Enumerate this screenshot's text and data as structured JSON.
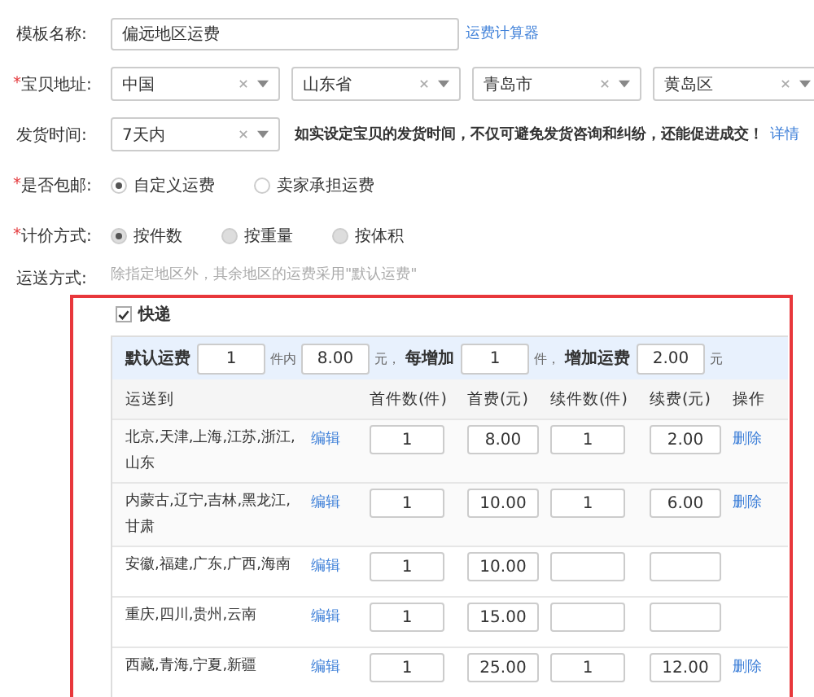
{
  "form": {
    "fields": [
      {
        "kind": "text",
        "label": "模板名称:",
        "value": "偏远地区运费",
        "link": "运费计算器"
      },
      {
        "kind": "selects",
        "label": "宝贝地址:",
        "marker": "*",
        "selects": [
          "中国",
          "山东省",
          "青岛市",
          "黄岛区"
        ]
      },
      {
        "kind": "select",
        "label": "发货时间:",
        "value": "7天内",
        "note": "如实设定宝贝的发货时间，不仅可避免发货咨询和纠纷，还能促进成交！",
        "link": "详情"
      },
      {
        "kind": "radios",
        "label": "是否包邮:",
        "marker": "*",
        "disabled": false,
        "options": [
          {
            "label": "自定义运费",
            "selected": true
          },
          {
            "label": "卖家承担运费",
            "selected": false
          }
        ]
      },
      {
        "kind": "radios",
        "label": "计价方式:",
        "marker": "*",
        "disabled": true,
        "options": [
          {
            "label": "按件数",
            "selected": true
          },
          {
            "label": "按重量",
            "selected": false
          },
          {
            "label": "按体积",
            "selected": false
          }
        ]
      }
    ],
    "shipping": {
      "label": "运送方式:",
      "hint": "除指定地区外，其余地区的运费采用\"默认运费\"",
      "method": {
        "label": "快递",
        "checked": true
      },
      "default_rule": [
        {
          "kind": "label",
          "text": "默认运费"
        },
        {
          "kind": "input",
          "text": "1"
        },
        {
          "kind": "unit",
          "text": "件内"
        },
        {
          "kind": "input",
          "text": "8.00"
        },
        {
          "kind": "unit",
          "text": "元，"
        },
        {
          "kind": "label",
          "text": "每增加"
        },
        {
          "kind": "input",
          "text": "1"
        },
        {
          "kind": "unit",
          "text": "件，"
        },
        {
          "kind": "label",
          "text": "增加运费"
        },
        {
          "kind": "input",
          "text": "2.00"
        },
        {
          "kind": "unit",
          "text": "元"
        }
      ],
      "table": {
        "columns": [
          "运送到",
          "首件数(件)",
          "首费(元)",
          "续件数(件)",
          "续费(元)",
          "操作"
        ],
        "rows": [
          {
            "regions": "北京,天津,上海,江苏,浙江,山东",
            "edit": "编辑",
            "first_count": "1",
            "first_fee": "8.00",
            "extra_count": "1",
            "extra_fee": "2.00",
            "action": "删除"
          },
          {
            "regions": "内蒙古,辽宁,吉林,黑龙江,甘肃",
            "edit": "编辑",
            "first_count": "1",
            "first_fee": "10.00",
            "extra_count": "1",
            "extra_fee": "6.00",
            "action": "删除"
          },
          {
            "regions": "安徽,福建,广东,广西,海南",
            "edit": "编辑",
            "first_count": "1",
            "first_fee": "10.00"
          },
          {
            "regions": "重庆,四川,贵州,云南",
            "edit": "编辑",
            "first_count": "1",
            "first_fee": "15.00"
          },
          {
            "regions": "西藏,青海,宁夏,新疆",
            "edit": "编辑",
            "first_count": "1",
            "first_fee": "25.00",
            "extra_count": "1",
            "extra_fee": "12.00",
            "action": "删除"
          }
        ]
      }
    }
  }
}
